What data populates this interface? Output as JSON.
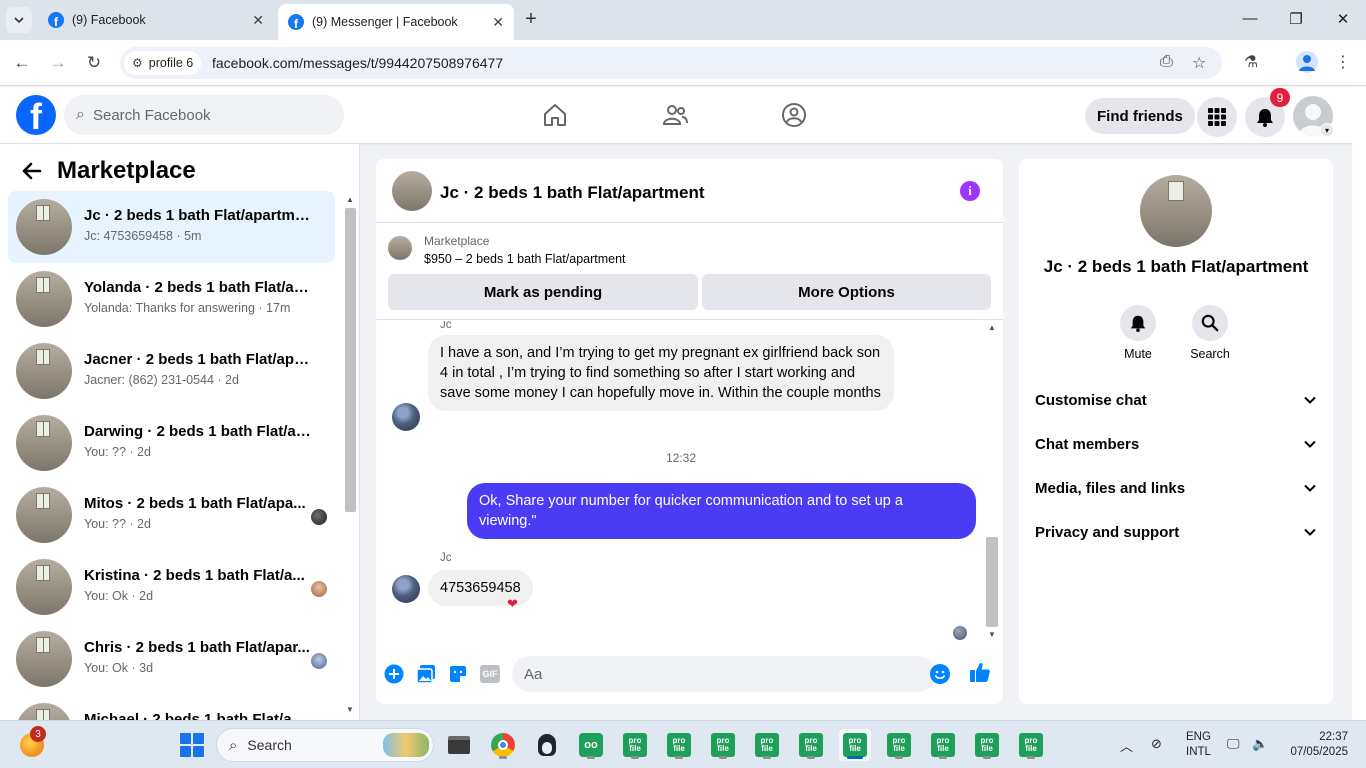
{
  "browser": {
    "tabs": [
      {
        "title": "(9) Facebook"
      },
      {
        "title": "(9) Messenger | Facebook"
      }
    ],
    "profile_chip": "profile 6",
    "url": "facebook.com/messages/t/9944207508976477"
  },
  "fb_header": {
    "search_placeholder": "Search Facebook",
    "find_friends": "Find friends",
    "notification_count": "9"
  },
  "left_panel": {
    "title": "Marketplace",
    "chats": [
      {
        "name": "Jc · 2 beds 1 bath Flat/apartment",
        "preview": "Jc: 4753659458 · 5m"
      },
      {
        "name": "Yolanda · 2 beds 1 bath Flat/apa...",
        "preview": "Yolanda: Thanks for answering · 17m"
      },
      {
        "name": "Jacner · 2 beds 1 bath Flat/apart...",
        "preview": "Jacner: (862) 231-0544 · 2d"
      },
      {
        "name": "Darwing · 2 beds 1 bath Flat/ap...",
        "preview": "You: ?? · 2d"
      },
      {
        "name": "Mitos · 2 beds 1 bath Flat/apa...",
        "preview": "You: ?? · 2d"
      },
      {
        "name": "Kristina · 2 beds 1 bath Flat/a...",
        "preview": "You: Ok · 2d"
      },
      {
        "name": "Chris · 2 beds 1 bath Flat/apar...",
        "preview": "You: Ok · 3d"
      },
      {
        "name": "Michael · 2 beds 1 bath Flat/a...",
        "preview": ""
      }
    ]
  },
  "conversation": {
    "title": "Jc · 2 beds 1 bath Flat/apartment",
    "marketplace_label": "Marketplace",
    "listing": "$950 – 2 beds 1 bath Flat/apartment",
    "mark_pending": "Mark as pending",
    "more_options": "More Options",
    "sender_name_1": "Jc",
    "msg_in_1": "I have a son, and I’m trying to get my pregnant ex girlfriend back son 4 in total , I’m trying to find something so after I start working and save some money I can hopefully move in. Within the couple months",
    "timestamp": "12:32",
    "msg_out_1": "Ok, Share your number for quicker communication and to set up a viewing.\"",
    "sender_name_2": "Jc",
    "msg_in_2": "4753659458",
    "reaction": "❤",
    "composer_placeholder": "Aa",
    "gif_label": "GIF"
  },
  "right_panel": {
    "name": "Jc · 2 beds 1 bath Flat/apartment",
    "actions": [
      {
        "label": "Mute"
      },
      {
        "label": "Search"
      }
    ],
    "sections": [
      {
        "label": "Customise chat"
      },
      {
        "label": "Chat members"
      },
      {
        "label": "Media, files and links"
      },
      {
        "label": "Privacy and support"
      }
    ]
  },
  "taskbar": {
    "weather_badge": "3",
    "search_label": "Search",
    "pinned_label_line1": "pro",
    "pinned_label_line2": "file",
    "lang_line1": "ENG",
    "lang_line2": "INTL",
    "time": "22:37",
    "date": "07/05/2025"
  },
  "colors": {
    "fb_blue": "#0866ff",
    "outgoing_bubble": "#4a3bf5",
    "active_chat_bg": "#e7f3ff",
    "notification_red": "#e41e3f",
    "info_purple": "#a033ff"
  }
}
